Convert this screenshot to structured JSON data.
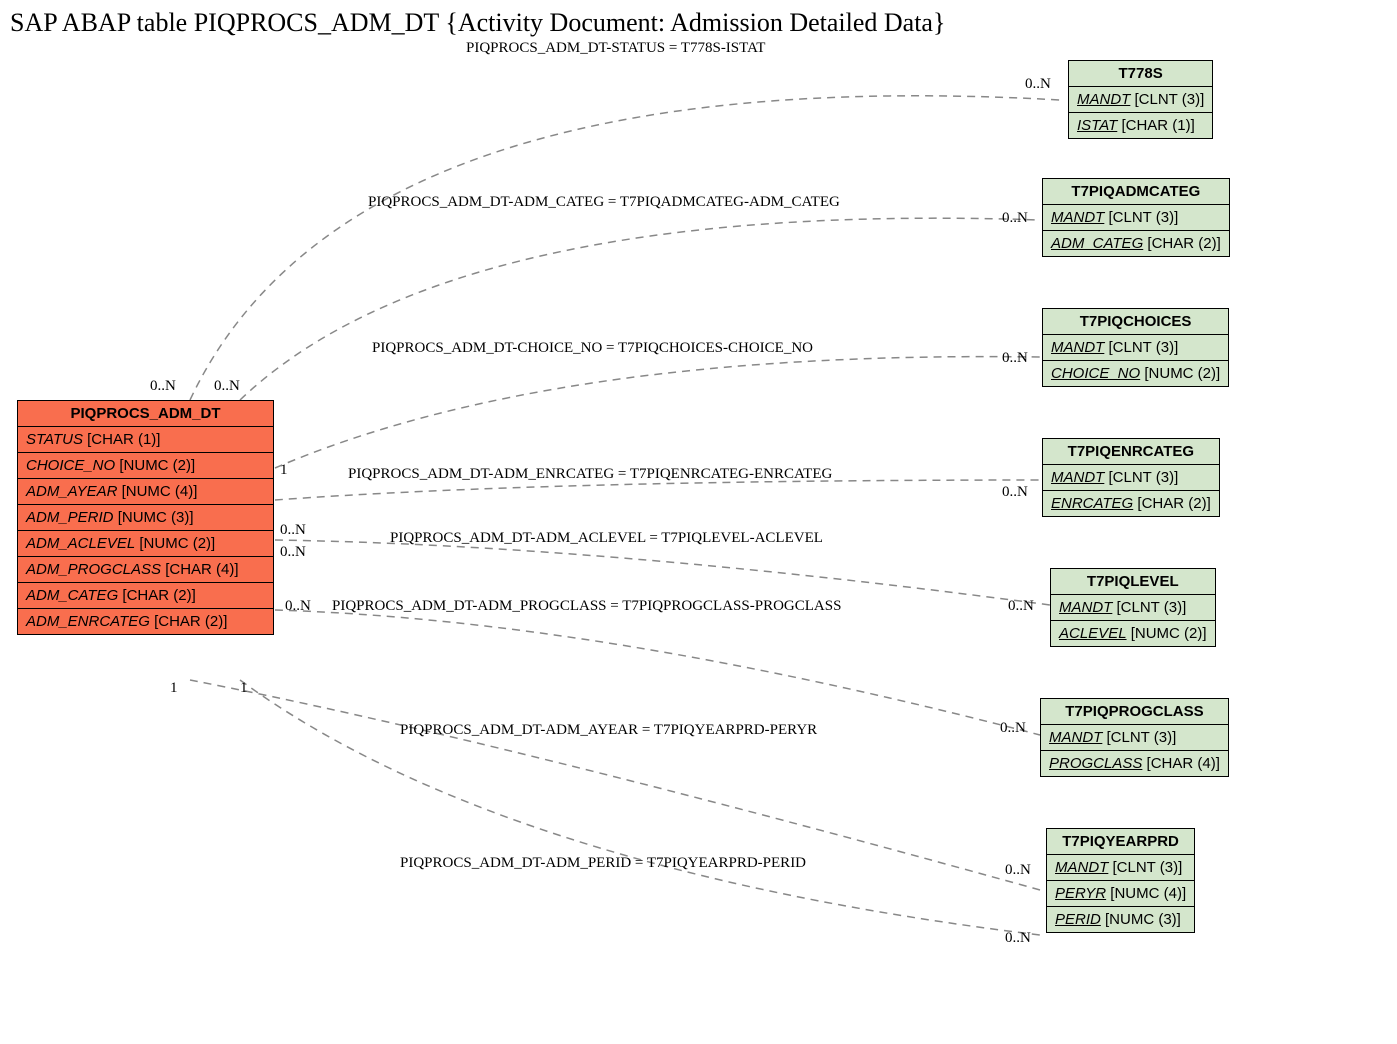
{
  "title": "SAP ABAP table PIQPROCS_ADM_DT {Activity Document: Admission Detailed Data}",
  "main_entity": {
    "name": "PIQPROCS_ADM_DT",
    "fields": [
      {
        "name": "STATUS",
        "type": "[CHAR (1)]"
      },
      {
        "name": "CHOICE_NO",
        "type": "[NUMC (2)]"
      },
      {
        "name": "ADM_AYEAR",
        "type": "[NUMC (4)]"
      },
      {
        "name": "ADM_PERID",
        "type": "[NUMC (3)]"
      },
      {
        "name": "ADM_ACLEVEL",
        "type": "[NUMC (2)]"
      },
      {
        "name": "ADM_PROGCLASS",
        "type": "[CHAR (4)]"
      },
      {
        "name": "ADM_CATEG",
        "type": "[CHAR (2)]"
      },
      {
        "name": "ADM_ENRCATEG",
        "type": "[CHAR (2)]"
      }
    ]
  },
  "entities": [
    {
      "name": "T778S",
      "fields": [
        {
          "name": "MANDT",
          "type": "[CLNT (3)]",
          "u": true
        },
        {
          "name": "ISTAT",
          "type": "[CHAR (1)]",
          "u": true
        }
      ]
    },
    {
      "name": "T7PIQADMCATEG",
      "fields": [
        {
          "name": "MANDT",
          "type": "[CLNT (3)]",
          "u": true
        },
        {
          "name": "ADM_CATEG",
          "type": "[CHAR (2)]",
          "u": true
        }
      ]
    },
    {
      "name": "T7PIQCHOICES",
      "fields": [
        {
          "name": "MANDT",
          "type": "[CLNT (3)]",
          "u": true
        },
        {
          "name": "CHOICE_NO",
          "type": "[NUMC (2)]",
          "u": true
        }
      ]
    },
    {
      "name": "T7PIQENRCATEG",
      "fields": [
        {
          "name": "MANDT",
          "type": "[CLNT (3)]",
          "u": true
        },
        {
          "name": "ENRCATEG",
          "type": "[CHAR (2)]",
          "u": true
        }
      ]
    },
    {
      "name": "T7PIQLEVEL",
      "fields": [
        {
          "name": "MANDT",
          "type": "[CLNT (3)]",
          "u": true
        },
        {
          "name": "ACLEVEL",
          "type": "[NUMC (2)]",
          "u": true
        }
      ]
    },
    {
      "name": "T7PIQPROGCLASS",
      "fields": [
        {
          "name": "MANDT",
          "type": "[CLNT (3)]",
          "u": true
        },
        {
          "name": "PROGCLASS",
          "type": "[CHAR (4)]",
          "u": true
        }
      ]
    },
    {
      "name": "T7PIQYEARPRD",
      "fields": [
        {
          "name": "MANDT",
          "type": "[CLNT (3)]",
          "u": true
        },
        {
          "name": "PERYR",
          "type": "[NUMC (4)]",
          "u": true
        },
        {
          "name": "PERID",
          "type": "[NUMC (3)]",
          "u": true
        }
      ]
    }
  ],
  "relations": [
    {
      "label": "PIQPROCS_ADM_DT-STATUS = T778S-ISTAT"
    },
    {
      "label": "PIQPROCS_ADM_DT-ADM_CATEG = T7PIQADMCATEG-ADM_CATEG"
    },
    {
      "label": "PIQPROCS_ADM_DT-CHOICE_NO = T7PIQCHOICES-CHOICE_NO"
    },
    {
      "label": "PIQPROCS_ADM_DT-ADM_ENRCATEG = T7PIQENRCATEG-ENRCATEG"
    },
    {
      "label": "PIQPROCS_ADM_DT-ADM_ACLEVEL = T7PIQLEVEL-ACLEVEL"
    },
    {
      "label": "PIQPROCS_ADM_DT-ADM_PROGCLASS = T7PIQPROGCLASS-PROGCLASS"
    },
    {
      "label": "PIQPROCS_ADM_DT-ADM_AYEAR = T7PIQYEARPRD-PERYR"
    },
    {
      "label": "PIQPROCS_ADM_DT-ADM_PERID = T7PIQYEARPRD-PERID"
    }
  ],
  "cards": {
    "zn": "0..N",
    "one": "1"
  }
}
